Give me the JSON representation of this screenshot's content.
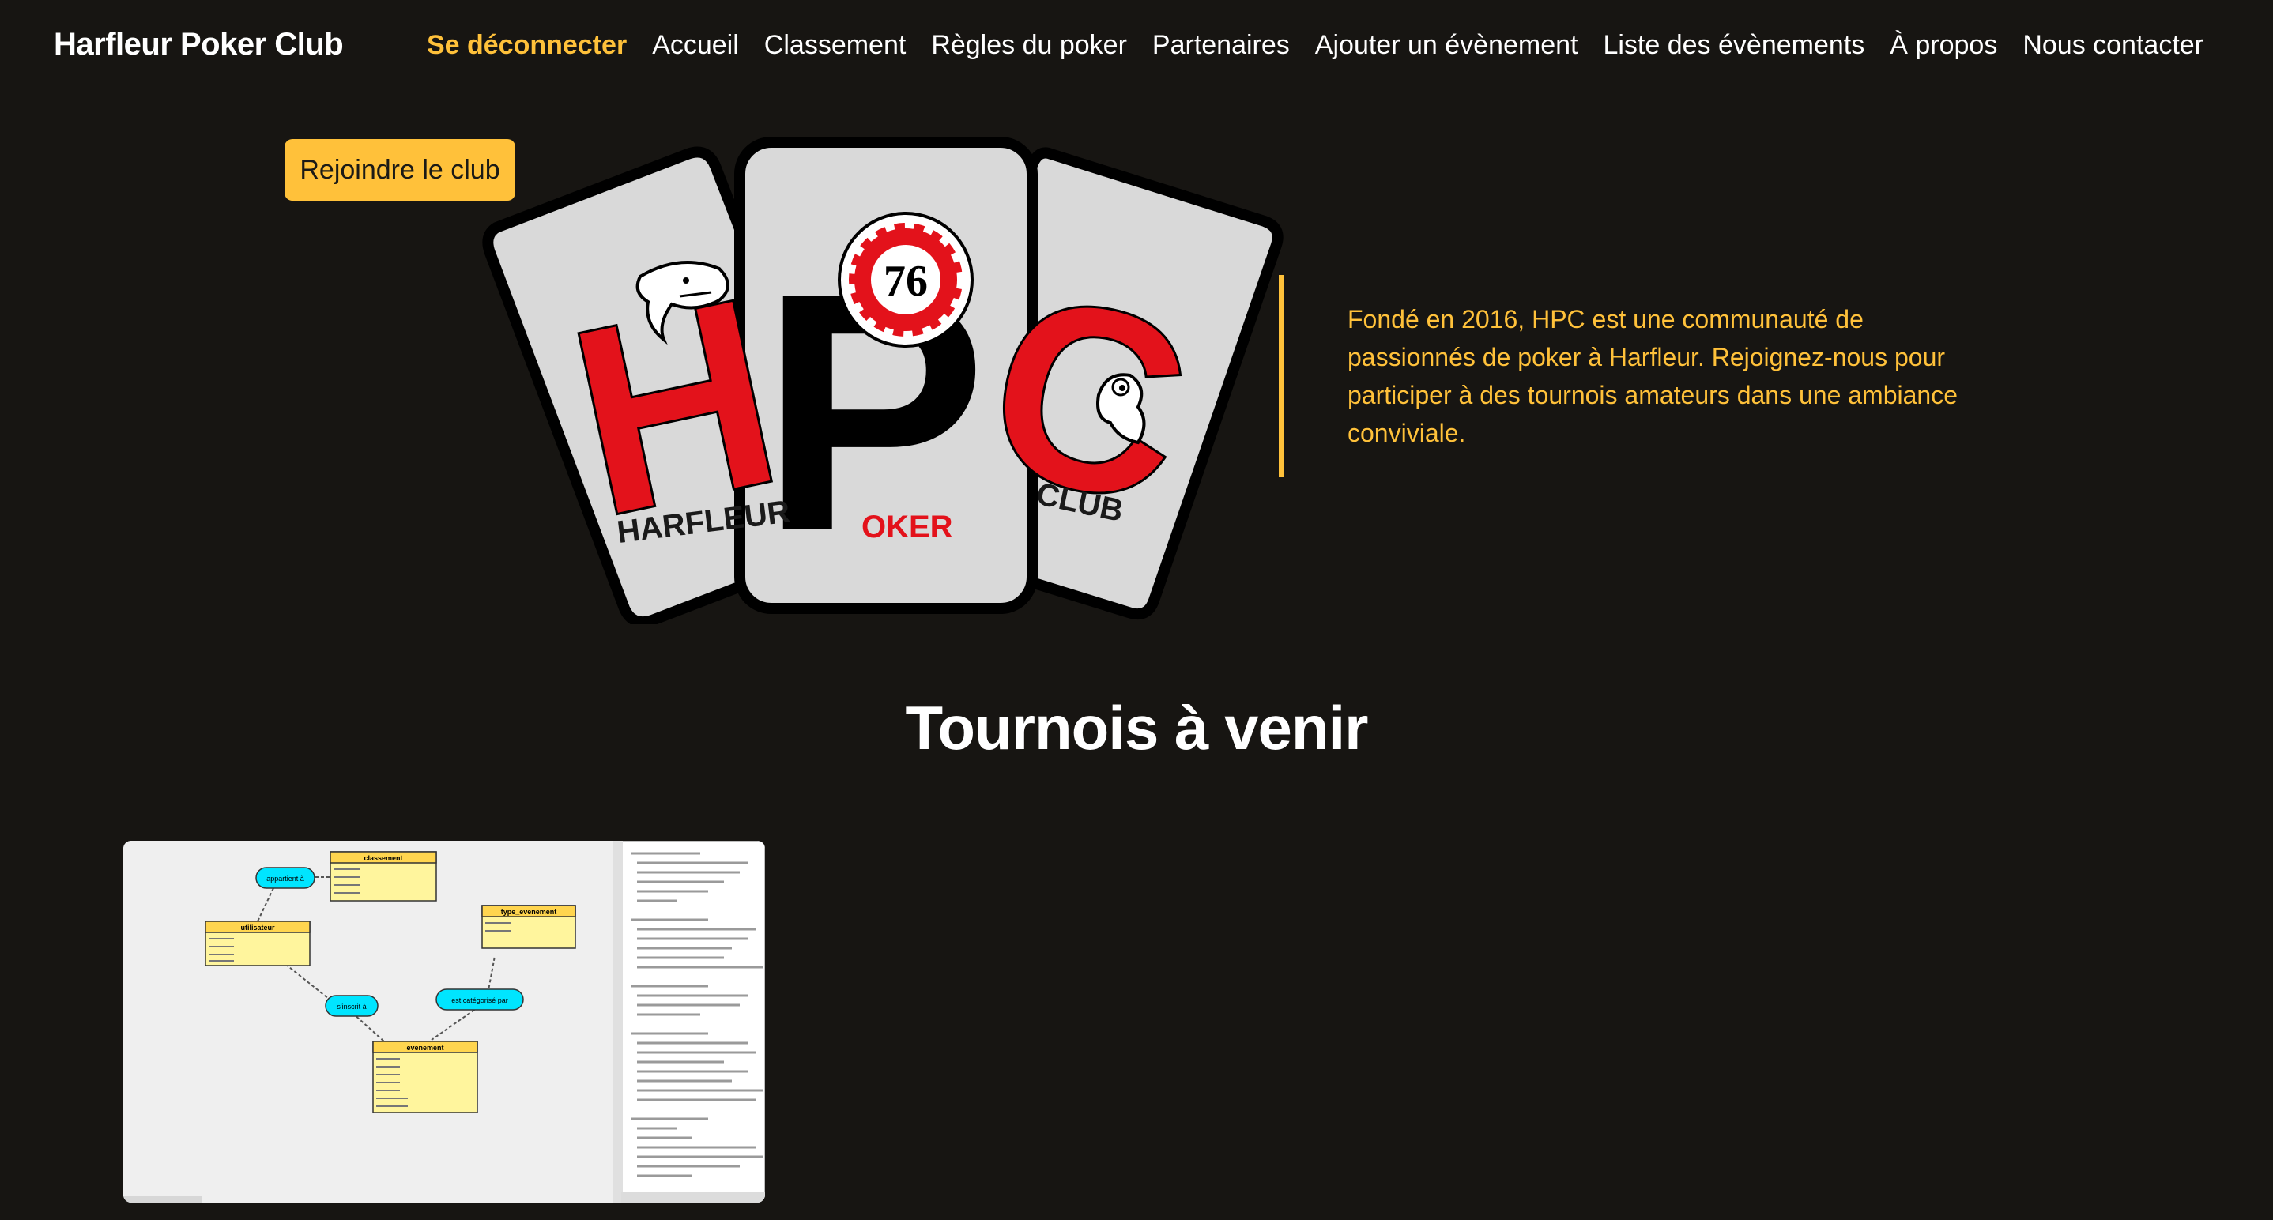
{
  "header": {
    "brand": "Harfleur Poker Club",
    "nav": [
      {
        "label": "Se déconnecter",
        "accent": true
      },
      {
        "label": "Accueil"
      },
      {
        "label": "Classement"
      },
      {
        "label": "Règles du poker"
      },
      {
        "label": "Partenaires"
      },
      {
        "label": "Ajouter un évènement"
      },
      {
        "label": "Liste des évènements"
      },
      {
        "label": "À propos"
      },
      {
        "label": "Nous contacter"
      }
    ]
  },
  "hero": {
    "join_label": "Rejoindre le club",
    "intro": "Fondé en 2016, HPC est une communauté de passionnés de poker à Harfleur. Rejoignez-nous pour participer à des tournois amateurs dans une ambiance conviviale.",
    "logo": {
      "letters": [
        "H",
        "P",
        "C"
      ],
      "chip_number": "76",
      "word_left": "HARFLEUR",
      "word_middle": "OKER",
      "word_right": "CLUB"
    }
  },
  "tournaments": {
    "title": "Tournois à venir",
    "cards": [
      {
        "diagram": {
          "tables": [
            "classement",
            "utilisateur",
            "type_evenement",
            "evenement"
          ],
          "relations": [
            "appartient à",
            "s'inscrit à",
            "est catégorisé par"
          ]
        }
      }
    ]
  },
  "colors": {
    "background": "#171512",
    "accent": "#ffc13a",
    "logo_red": "#e3121b",
    "logo_card": "#d9d9d9"
  }
}
